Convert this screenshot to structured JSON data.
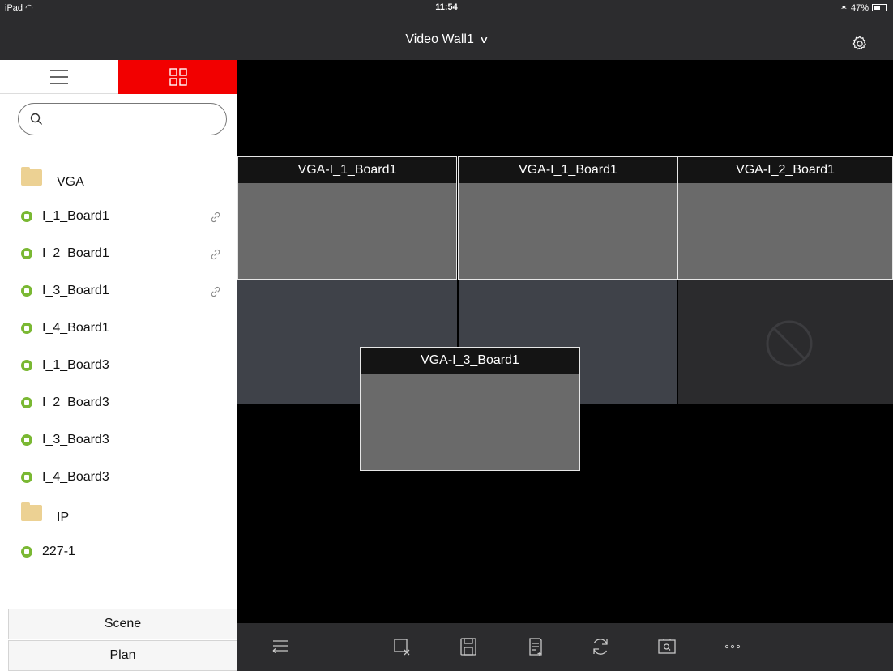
{
  "status_bar": {
    "carrier": "iPad",
    "time": "11:54",
    "battery": "47%"
  },
  "nav": {
    "title": "Video Wall1",
    "settings_icon": "gear-icon",
    "dropdown_icon": "chevron-down-icon"
  },
  "sidebar": {
    "segment": {
      "list_icon": "list-icon",
      "grid_icon": "grid-icon",
      "active": "grid",
      "active_color": "#f20000"
    },
    "search": {
      "placeholder": "",
      "value": ""
    },
    "groups": [
      {
        "label": "VGA",
        "items": [
          {
            "label": "I_1_Board1",
            "linked": true
          },
          {
            "label": "I_2_Board1",
            "linked": true
          },
          {
            "label": "I_3_Board1",
            "linked": true
          },
          {
            "label": "I_4_Board1",
            "linked": false
          },
          {
            "label": "I_1_Board3",
            "linked": false
          },
          {
            "label": "I_2_Board3",
            "linked": false
          },
          {
            "label": "I_3_Board3",
            "linked": false
          },
          {
            "label": "I_4_Board3",
            "linked": false
          }
        ]
      },
      {
        "label": "IP",
        "items": [
          {
            "label": "227-1",
            "linked": false
          }
        ]
      }
    ],
    "scene_label": "Scene",
    "plan_label": "Plan"
  },
  "wall": {
    "windows": [
      {
        "title": "VGA-I_1_Board1"
      },
      {
        "title": "VGA-I_1_Board1"
      },
      {
        "title": "VGA-I_2_Board1"
      },
      {
        "title": "VGA-I_3_Board1"
      }
    ],
    "disabled_screen_icon": "forbidden-icon"
  },
  "toolbar": {
    "buttons": [
      "collapse-list-icon",
      "close-window-icon",
      "save-icon",
      "add-plan-icon",
      "refresh-icon",
      "preview-icon",
      "more-icon"
    ]
  },
  "colors": {
    "accent": "#f20000",
    "online": "#7ab833",
    "folder": "#ecd193",
    "bar": "#2c2c2e"
  }
}
